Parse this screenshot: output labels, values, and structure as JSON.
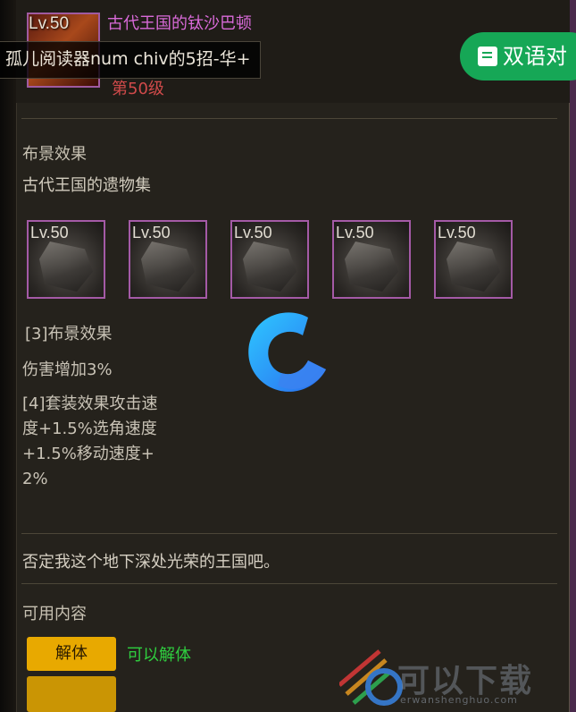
{
  "item": {
    "level_badge": "Lv.50",
    "name": "古代王国的钛沙巴顿",
    "level_text": "第50级"
  },
  "overlay": {
    "title": "孤儿阅读器num chiv的5招-华+"
  },
  "dual_button": {
    "label": "双语对"
  },
  "set_effect": {
    "title": "布景效果",
    "set_name": "古代王国的遗物集",
    "slots": [
      {
        "level": "Lv.50"
      },
      {
        "level": "Lv.50"
      },
      {
        "level": "Lv.50"
      },
      {
        "level": "Lv.50"
      },
      {
        "level": "Lv.50"
      }
    ],
    "bonus3_header": "[3]布景效果",
    "bonus3_text": "伤害增加3%",
    "bonus4_line1": "[4]套装效果攻击速",
    "bonus4_line2": "度+1.5%选角速度",
    "bonus4_line3": "+1.5%移动速度+",
    "bonus4_line4": "2%"
  },
  "description": "否定我这个地下深处光荣的王国吧。",
  "available": {
    "title": "可用内容",
    "disassemble_button": "解体",
    "disassemble_status": "可以解体"
  },
  "colors": {
    "item_name": "#d86ad8",
    "item_level": "#d04a4a",
    "slot_border": "#a45aa6",
    "gold_button": "#e8a900",
    "green_status": "#2fcf3f",
    "dual_button": "#16a756"
  },
  "watermark": {
    "text": "可以下载",
    "sub": "erwanshenghuo.com"
  }
}
